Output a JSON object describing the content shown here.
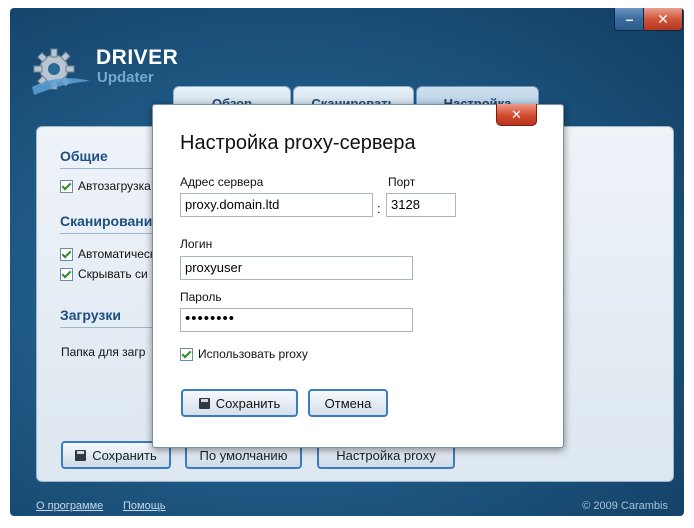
{
  "window": {
    "minimize_glyph": "–",
    "close_glyph": "✕"
  },
  "brand": {
    "title": "DRIVER",
    "subtitle": "Updater"
  },
  "tabs": [
    {
      "label": "Обзор"
    },
    {
      "label": "Сканировать"
    },
    {
      "label": "Настройка"
    }
  ],
  "panel": {
    "general_title": "Общие",
    "autoload_label": "Автозагрузка",
    "scan_title": "Сканирование",
    "auto_label": "Автоматически",
    "hide_label": "Скрывать си",
    "downloads_title": "Загрузки",
    "folder_label": "Папка для загр",
    "buttons": {
      "save": "Сохранить",
      "defaults": "По умолчанию",
      "proxy": "Настройка proxy"
    }
  },
  "footer": {
    "about": "О программе",
    "help": "Помощь",
    "copyright": "© 2009 Carambis"
  },
  "dialog": {
    "title": "Настройка proxy-сервера",
    "server_label": "Адрес сервера",
    "server_value": "proxy.domain.ltd",
    "port_label": "Порт",
    "port_value": "3128",
    "login_label": "Логин",
    "login_value": "proxyuser",
    "password_label": "Пароль",
    "password_value": "••••••••",
    "use_proxy_label": "Использовать proxy",
    "use_proxy_checked": true,
    "save_button": "Сохранить",
    "cancel_button": "Отмена",
    "close_glyph": "✕"
  },
  "colors": {
    "window_bg": "#1f5a85",
    "accent_border": "#3a7cc4",
    "close_red": "#d04a30",
    "section_title": "#1e4f82"
  },
  "icons": [
    "gear-logo-icon",
    "minimize-icon",
    "close-icon",
    "diskette-icon",
    "check-icon"
  ]
}
